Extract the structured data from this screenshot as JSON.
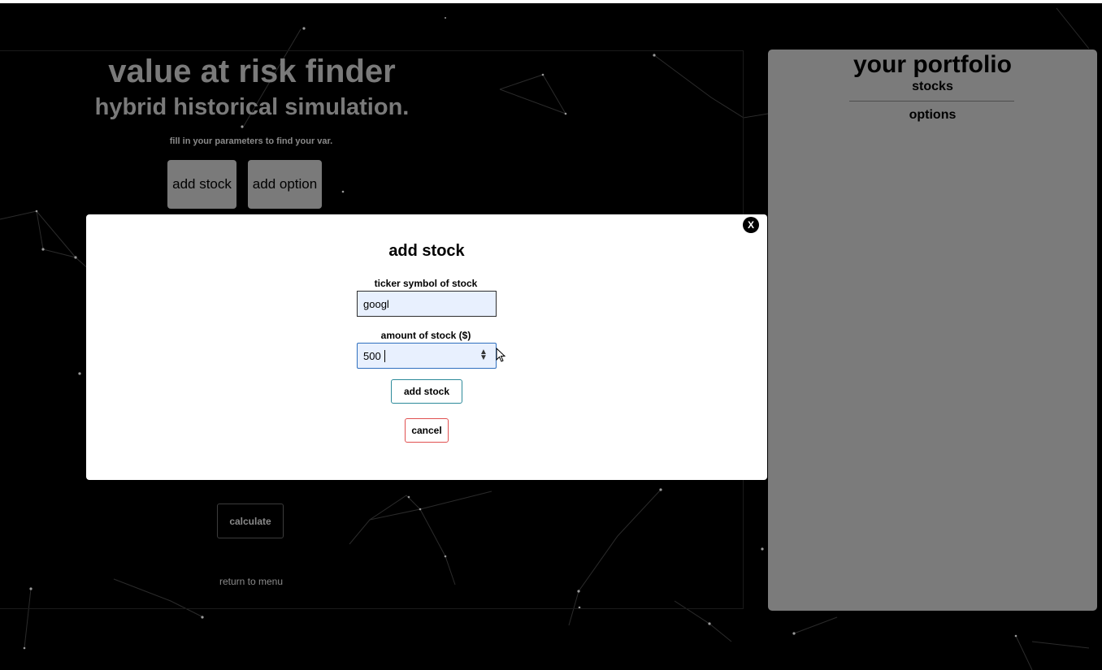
{
  "main": {
    "title": "value at risk finder",
    "subtitle": "hybrid historical simulation.",
    "hint": "fill in your parameters to find your var.",
    "add_stock_label": "add stock",
    "add_option_label": "add option",
    "calculate_label": "calculate",
    "return_label": "return to menu"
  },
  "portfolio": {
    "title": "your portfolio",
    "stocks_label": "stocks",
    "options_label": "options"
  },
  "modal": {
    "close_label": "X",
    "title": "add stock",
    "ticker_label": "ticker symbol of stock",
    "ticker_value": "googl",
    "amount_label": "amount of stock ($)",
    "amount_value": "500",
    "submit_label": "add stock",
    "cancel_label": "cancel"
  },
  "colors": {
    "background": "#000000",
    "panel_grey": "#7b7b7b",
    "input_fill": "#e8f0fe",
    "submit_border": "#2d8a9a",
    "cancel_border": "#e05050"
  }
}
